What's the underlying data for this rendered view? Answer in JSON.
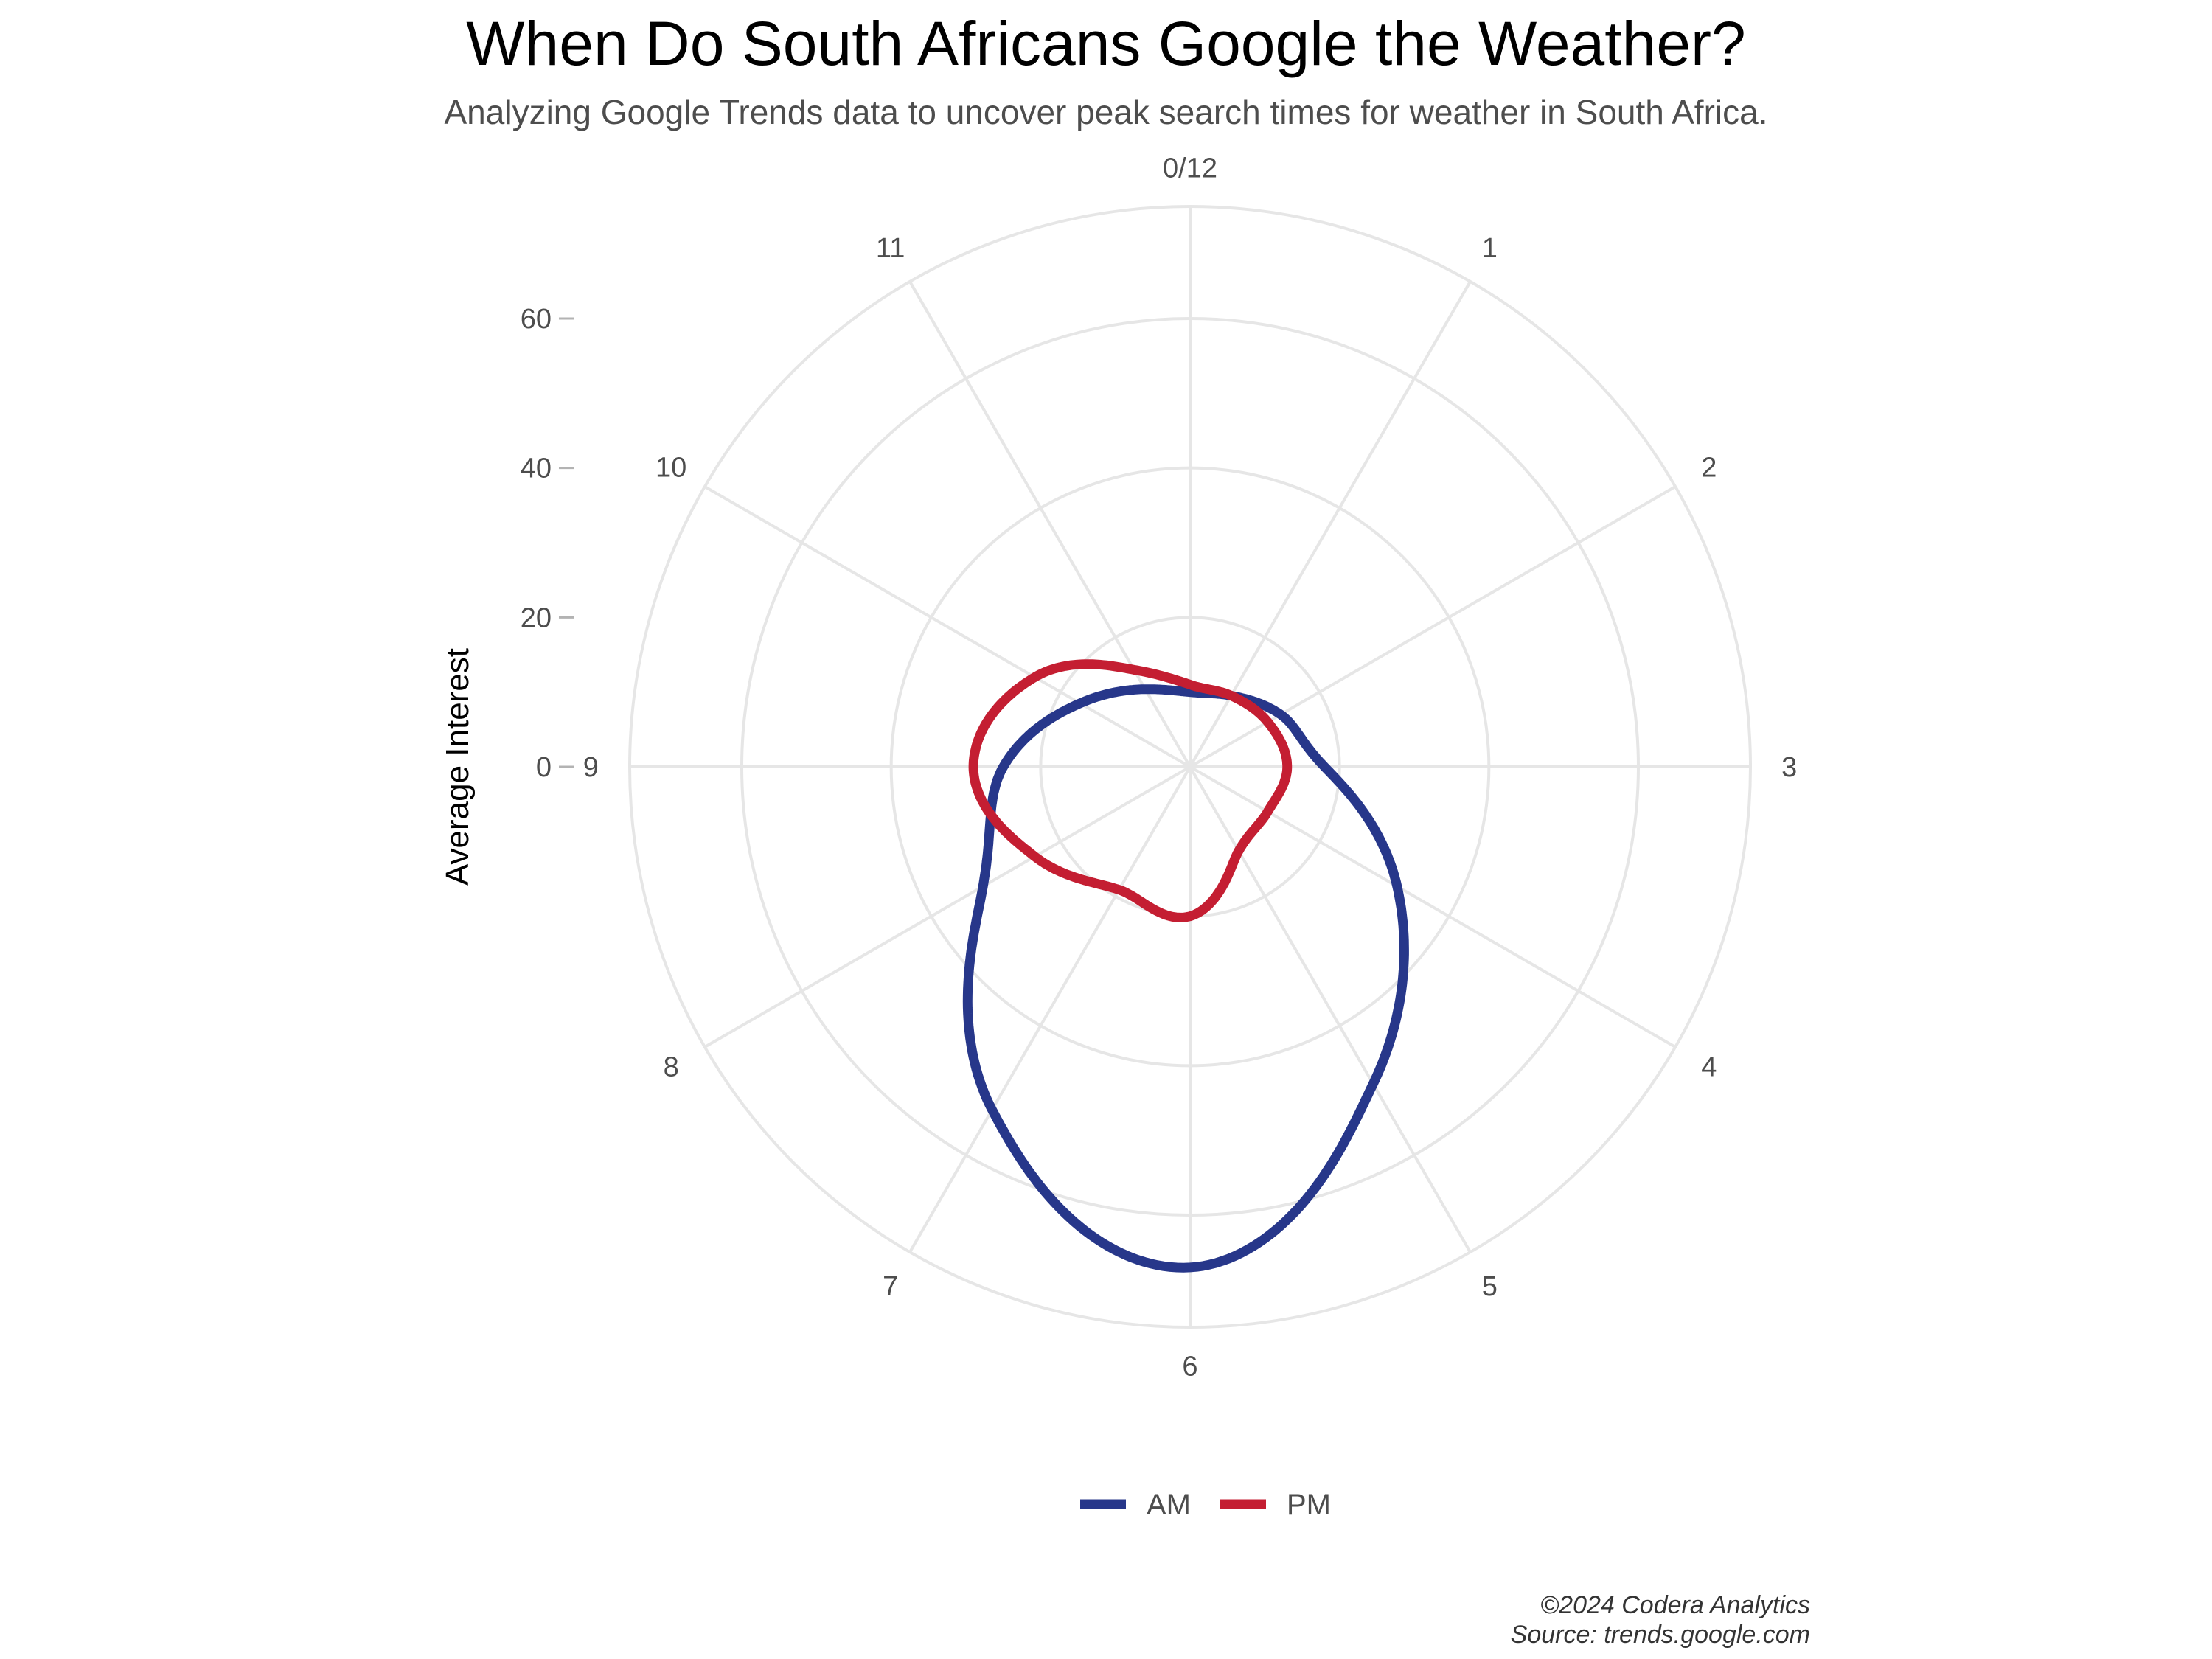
{
  "chart_data": {
    "type": "line",
    "coord": "polar",
    "title": "When Do South Africans Google the Weather?",
    "subtitle": "Analyzing Google Trends data to uncover peak search times for weather in South Africa.",
    "ylabel": "Average Interest",
    "theta_labels": [
      "0/12",
      "1",
      "2",
      "3",
      "4",
      "5",
      "6",
      "7",
      "8",
      "9",
      "10",
      "11"
    ],
    "r_ticks": [
      0,
      20,
      40,
      60
    ],
    "r_lim": [
      0,
      75
    ],
    "grid": true,
    "legend_position": "bottom",
    "series": [
      {
        "name": "AM",
        "color": "#27378a",
        "x": [
          0,
          1,
          2,
          3,
          4,
          5,
          6,
          7,
          8,
          9,
          10,
          11,
          12
        ],
        "values": [
          10,
          11,
          14,
          18,
          32,
          49,
          67,
          53,
          32,
          25,
          17,
          12,
          10
        ]
      },
      {
        "name": "PM",
        "color": "#c41e32",
        "x": [
          0,
          1,
          2,
          3,
          4,
          5,
          6,
          7,
          8,
          9,
          10,
          11,
          12
        ],
        "values": [
          11,
          11,
          12,
          13,
          12,
          13,
          20,
          19,
          24,
          29,
          24,
          15,
          11
        ]
      }
    ],
    "caption_lines": [
      "©2024 Codera Analytics",
      "Source: trends.google.com"
    ]
  }
}
